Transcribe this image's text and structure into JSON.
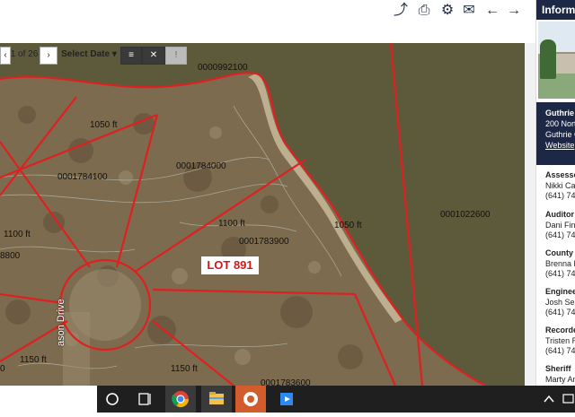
{
  "info_panel": {
    "header": "Informa",
    "office": {
      "name": "Guthrie C",
      "address1": "200 Nort",
      "address2": "Guthrie C",
      "website": "Website"
    },
    "contacts": [
      {
        "title": "Assessor",
        "name": "Nikki Cai",
        "phone": "(641) 747"
      },
      {
        "title": "Auditor",
        "name": "Dani Finl",
        "phone": "(641) 747"
      },
      {
        "title": "County A",
        "name": "Brenna B",
        "phone": "(641) 747"
      },
      {
        "title": "Engineer",
        "name": "Josh Seb",
        "phone": "(641) 747"
      },
      {
        "title": "Recorder",
        "name": "Tristen R",
        "phone": "(641) 747"
      },
      {
        "title": "Sheriff",
        "name": "Marty An",
        "phone": ""
      }
    ]
  },
  "map_controls": {
    "page_indicator": "1 of 26",
    "select_date": "Select Date"
  },
  "map": {
    "lot_label": "LOT 891",
    "parcel_ids": [
      "0000992100",
      "0001784000",
      "0001784100",
      "0001783900",
      "0001022600",
      "0001783600"
    ],
    "distance_labels": [
      "1050 ft",
      "1100 ft",
      "1100 ft",
      "1050 ft",
      "1150 ft",
      "1150 ft"
    ],
    "road_label": "ason Drive",
    "edge_labels": [
      "8800",
      "0"
    ]
  },
  "colors": {
    "panel_dark": "#1c2845",
    "parcel_line": "#e02020",
    "lot_label": "#d21818",
    "water": "#5d5a3c"
  },
  "icons": [
    "share-icon",
    "print-icon",
    "gear-icon",
    "mail-icon",
    "arrow-left-icon",
    "arrow-right-icon",
    "layers-icon",
    "tools-icon",
    "pin-icon",
    "search-circle-icon",
    "task-view-icon",
    "chrome-icon",
    "file-explorer-icon",
    "photos-icon",
    "media-icon",
    "chevron-up-icon",
    "notification-icon"
  ]
}
